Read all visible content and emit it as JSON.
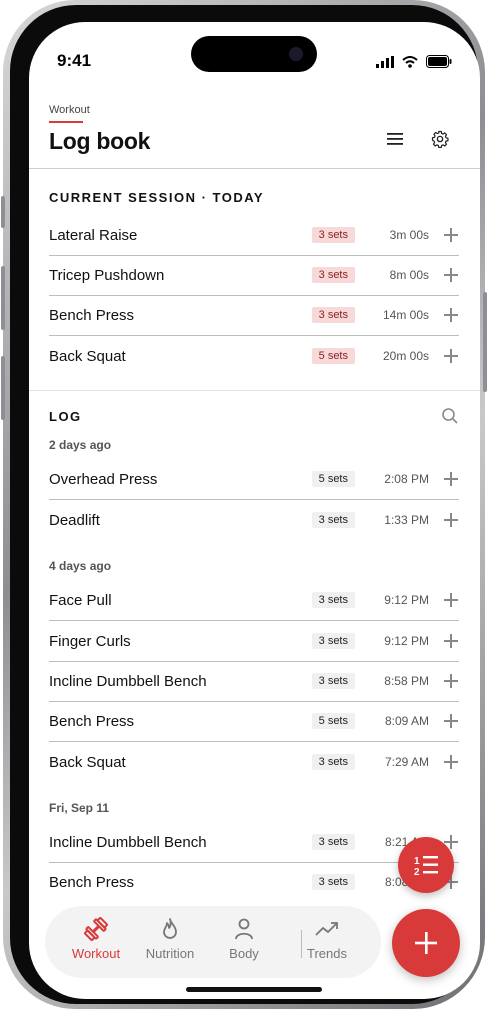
{
  "status": {
    "time": "9:41"
  },
  "header": {
    "overline": "Workout",
    "title": "Log book"
  },
  "colors": {
    "accent": "#d83a3a",
    "badge_red_bg": "#f7d9d9",
    "badge_gray_bg": "#f0f0f0"
  },
  "current": {
    "title": "CURRENT SESSION · TODAY",
    "items": [
      {
        "name": "Lateral Raise",
        "sets": "3 sets",
        "time": "3m 00s"
      },
      {
        "name": "Tricep Pushdown",
        "sets": "3 sets",
        "time": "8m 00s"
      },
      {
        "name": "Bench Press",
        "sets": "3 sets",
        "time": "14m 00s"
      },
      {
        "name": "Back Squat",
        "sets": "5 sets",
        "time": "20m 00s"
      }
    ]
  },
  "log": {
    "title": "LOG",
    "groups": [
      {
        "label": "2 days ago",
        "items": [
          {
            "name": "Overhead Press",
            "sets": "5 sets",
            "time": "2:08 PM"
          },
          {
            "name": "Deadlift",
            "sets": "3 sets",
            "time": "1:33 PM"
          }
        ]
      },
      {
        "label": "4 days ago",
        "items": [
          {
            "name": "Face Pull",
            "sets": "3 sets",
            "time": "9:12 PM"
          },
          {
            "name": "Finger Curls",
            "sets": "3 sets",
            "time": "9:12 PM"
          },
          {
            "name": "Incline Dumbbell Bench",
            "sets": "3 sets",
            "time": "8:58 PM"
          },
          {
            "name": "Bench Press",
            "sets": "5 sets",
            "time": "8:09 AM"
          },
          {
            "name": "Back Squat",
            "sets": "3 sets",
            "time": "7:29 AM"
          }
        ]
      },
      {
        "label": "Fri, Sep 11",
        "items": [
          {
            "name": "Incline Dumbbell Bench",
            "sets": "3 sets",
            "time": "8:21 AM"
          },
          {
            "name": "Bench Press",
            "sets": "3 sets",
            "time": "8:08 AM"
          }
        ]
      }
    ]
  },
  "tabs": [
    {
      "label": "Workout",
      "icon": "dumbbell-icon",
      "active": true
    },
    {
      "label": "Nutrition",
      "icon": "flame-icon",
      "active": false
    },
    {
      "label": "Body",
      "icon": "person-icon",
      "active": false
    },
    {
      "label": "Trends",
      "icon": "trend-up-icon",
      "active": false
    }
  ],
  "fab": {
    "reorder_icon": "ordered-list-icon",
    "add_icon": "plus-icon"
  }
}
